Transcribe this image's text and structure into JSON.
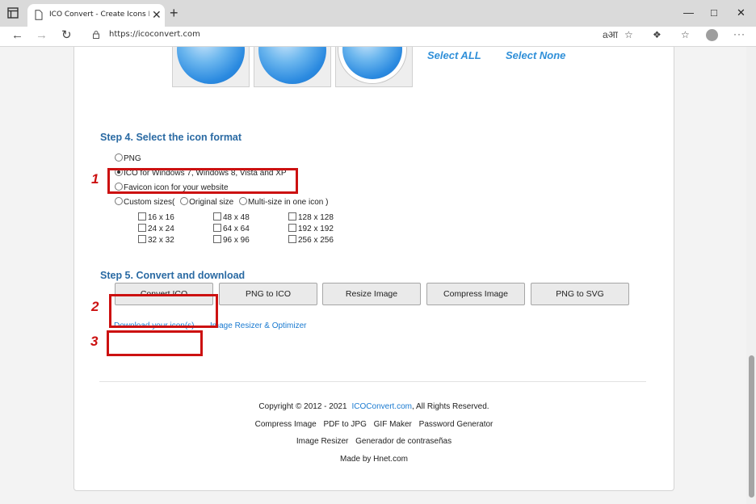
{
  "browser": {
    "tab_title": "ICO Convert - Create Icons From",
    "url": "https://icoconvert.com",
    "new_tab_glyph": "+",
    "close_tab_glyph": "✕"
  },
  "selection": {
    "select_all": "Select ALL",
    "select_none": "Select None"
  },
  "step4": {
    "heading": "Step 4. Select the icon format",
    "options": [
      {
        "label": "PNG",
        "selected": false
      },
      {
        "label": "ICO for Windows 7, Windows 8, Vista and XP",
        "selected": true
      },
      {
        "label": "Favicon icon for your website",
        "selected": false
      }
    ],
    "custom_label": "Custom sizes(",
    "original_size": "Original size",
    "multi_size": "Multi-size in one icon )",
    "sizes_col1": [
      "16 x 16",
      "24 x 24",
      "32 x 32"
    ],
    "sizes_col2": [
      "48 x 48",
      "64 x 64",
      "96 x 96"
    ],
    "sizes_col3": [
      "128 x 128",
      "192 x 192",
      "256 x 256"
    ]
  },
  "step5": {
    "heading": "Step 5. Convert and download",
    "buttons": [
      "Convert ICO",
      "PNG to ICO",
      "Resize Image",
      "Compress Image",
      "PNG to SVG"
    ],
    "download_link": "Download your icon(s)",
    "resizer_link": "Image Resizer & Optimizer"
  },
  "annotations": {
    "markers": [
      "1",
      "2",
      "3"
    ],
    "color": "#cc1111"
  },
  "footer": {
    "copyright_prefix": "Copyright © 2012 - 2021",
    "copyright_link": "ICOConvert.com",
    "copyright_suffix": ", All Rights Reserved.",
    "links_row1": [
      "Compress Image",
      "PDF to JPG",
      "GIF Maker",
      "Password Generator"
    ],
    "links_row2": [
      "Image Resizer",
      "Generador de contraseñas"
    ],
    "made_by": "Made by Hnet.com"
  },
  "colors": {
    "heading": "#2a6aa3",
    "link": "#1a7ad0",
    "select_links": "#2f8fd8"
  }
}
